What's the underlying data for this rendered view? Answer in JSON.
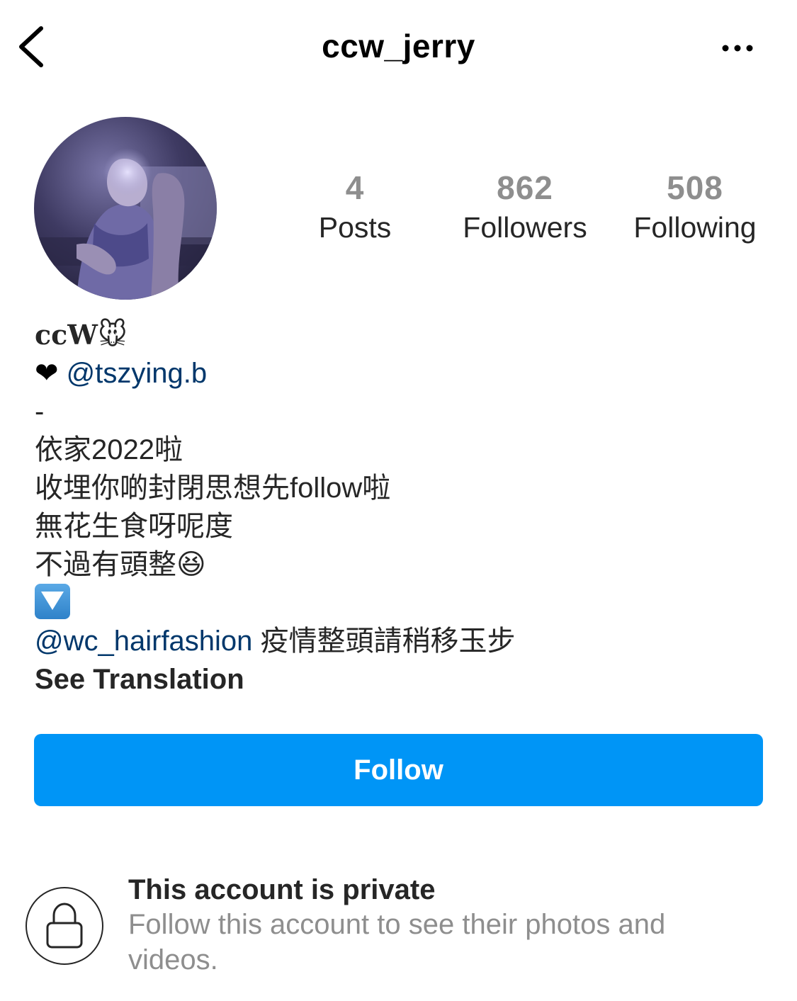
{
  "header": {
    "username": "ccw_jerry"
  },
  "stats": {
    "posts_count": "4",
    "posts_label": "Posts",
    "followers_count": "862",
    "followers_label": "Followers",
    "following_count": "508",
    "following_label": "Following"
  },
  "bio": {
    "name": "ccW",
    "name_emoji": "🐭",
    "heart": "❤",
    "partner_mention": "@tszying.b",
    "dash": "-",
    "line1": "依家2022啦",
    "line2": "收埋你啲封閉思想先follow啦",
    "line3": "無花生食呀呢度",
    "line4": "不過有頭整",
    "line4_emoji": "😆",
    "shop_mention": "@wc_hairfashion",
    "shop_text": " 疫情整頭請稍移玉步",
    "see_translation": "See Translation"
  },
  "actions": {
    "follow_label": "Follow"
  },
  "private_notice": {
    "title": "This account is private",
    "subtitle": "Follow this account to see their photos and videos."
  },
  "colors": {
    "primary_blue": "#0095f6",
    "mention_blue": "#00376b",
    "muted_gray": "#8e8e8e",
    "text": "#262626"
  }
}
